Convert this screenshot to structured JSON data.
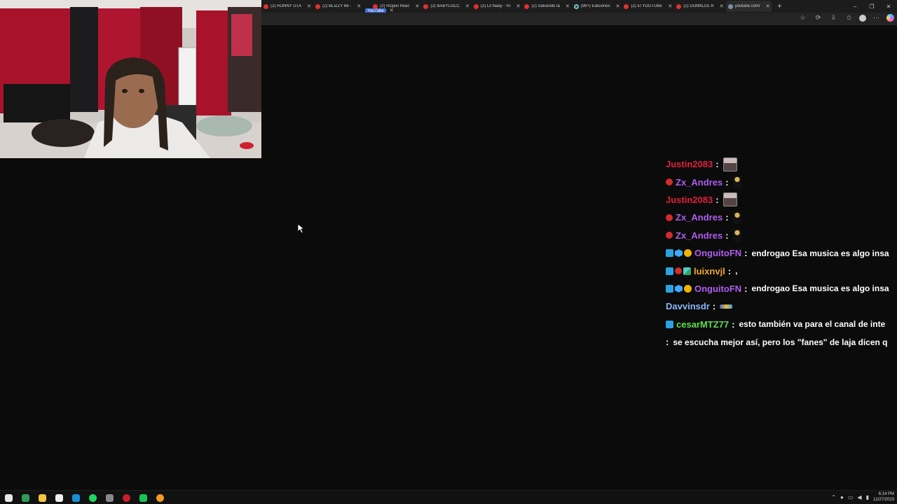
{
  "browser": {
    "tabs": [
      {
        "title": "(2) RONNY GTA",
        "favicon": "youtube-icon"
      },
      {
        "title": "(2) BLIZZY 68 -",
        "favicon": "youtube-icon"
      },
      {
        "title": "YouTube",
        "favicon": "youtube-icon",
        "style": "badge"
      },
      {
        "title": "(2) RDjavi Reac",
        "favicon": "youtube-icon"
      },
      {
        "title": "(2) BABYLOCC",
        "favicon": "youtube-icon"
      },
      {
        "title": "(2) Lil Naay - Yo",
        "favicon": "youtube-icon"
      },
      {
        "title": "(2) Salvando la",
        "favicon": "youtube-icon"
      },
      {
        "title": "(99+) Ediciones",
        "favicon": "tiktok-icon"
      },
      {
        "title": "(2) El YOUTUBE",
        "favicon": "youtube-icon"
      },
      {
        "title": "(2) DOMIILOL R",
        "favicon": "youtube-icon"
      },
      {
        "title": "youtube.com/",
        "favicon": "loading-icon",
        "active": true
      }
    ],
    "new_tab_glyph": "+",
    "window_controls": {
      "minimize": "–",
      "restore": "❐",
      "close": "✕"
    },
    "toolbar_icons": [
      "☆",
      "⟳",
      "⇩",
      "✩",
      "",
      "⋯",
      ""
    ]
  },
  "chat": [
    {
      "badges": [],
      "user": "Justin2083",
      "color": "#e0203c",
      "emote": "avatar",
      "text": ""
    },
    {
      "badges": [
        "red"
      ],
      "user": "Zx_Andres",
      "color": "#b05cf0",
      "emote": "figure",
      "text": ""
    },
    {
      "badges": [],
      "user": "Justin2083",
      "color": "#e0203c",
      "emote": "avatar",
      "text": ""
    },
    {
      "badges": [
        "red"
      ],
      "user": "Zx_Andres",
      "color": "#b05cf0",
      "emote": "figure",
      "text": ""
    },
    {
      "badges": [
        "red"
      ],
      "user": "Zx_Andres",
      "color": "#b05cf0",
      "emote": "figure",
      "text": ""
    },
    {
      "badges": [
        "blue",
        "cube",
        "gold"
      ],
      "user": "OnguitoFN",
      "color": "#b05cf0",
      "emote": "",
      "text": "endrogao Esa musica es algo insa"
    },
    {
      "badges": [
        "blue",
        "red",
        "multi"
      ],
      "user": "luixnvjl",
      "color": "#f0a830",
      "emote": "",
      "text": ","
    },
    {
      "badges": [
        "blue",
        "cube",
        "gold"
      ],
      "user": "OnguitoFN",
      "color": "#b05cf0",
      "emote": "",
      "text": "endrogao Esa musica es algo insa"
    },
    {
      "badges": [],
      "user": "Davvinsdr",
      "color": "#8ab4f8",
      "emote": "bar",
      "text": ""
    },
    {
      "badges": [
        "blue"
      ],
      "user": "cesarMTZ77",
      "color": "#5fe04a",
      "emote": "",
      "text": "esto también va para el canal de inte"
    },
    {
      "badges": [],
      "user": "",
      "color": "#ffffff",
      "emote": "",
      "text": "se escucha mejor así, pero los \"fanes\" de laja dicen q"
    }
  ],
  "taskbar": {
    "apps": [
      "windows-start",
      "terminal",
      "file-explorer",
      "notepad",
      "edge",
      "spotify",
      "app-pen",
      "obs",
      "app-green",
      "chrome"
    ],
    "clock_time": "6:14 PM",
    "clock_date": "12/27/2023"
  }
}
